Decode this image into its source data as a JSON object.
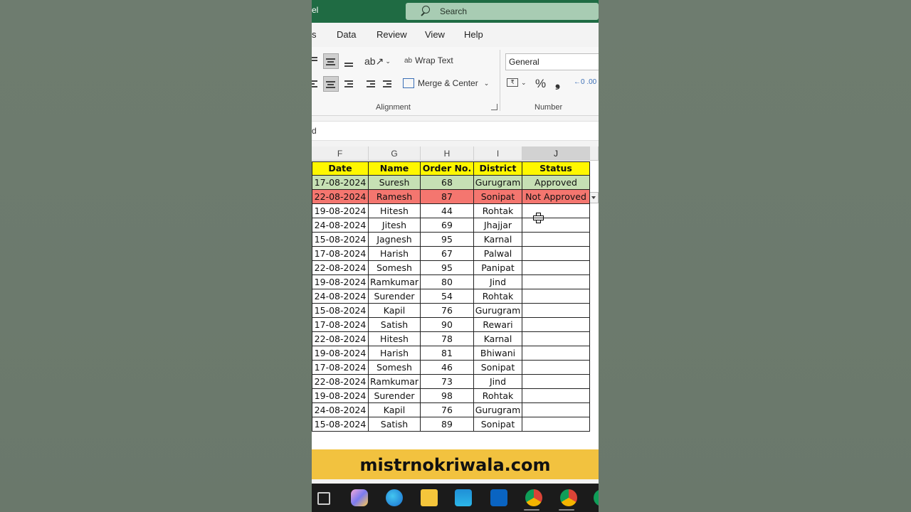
{
  "titlebar": {
    "app_fragment": "el",
    "search_label": "Search"
  },
  "ribbon_tabs": [
    "s",
    "Data",
    "Review",
    "View",
    "Help"
  ],
  "ribbon": {
    "wrap_text": "Wrap Text",
    "merge_center": "Merge & Center",
    "alignment_group": "Alignment",
    "number_format": "General",
    "number_group": "Number",
    "percent": "%",
    "comma": "❟"
  },
  "formula_bar": {
    "fragment": "d"
  },
  "columns": [
    "F",
    "G",
    "H",
    "I",
    "J"
  ],
  "selected_column": "J",
  "table": {
    "headers": [
      "Date",
      "Name",
      "Order No.",
      "District",
      "Status"
    ],
    "rows": [
      [
        "17-08-2024",
        "Suresh",
        "68",
        "Gurugram",
        "Approved"
      ],
      [
        "22-08-2024",
        "Ramesh",
        "87",
        "Sonipat",
        "Not Approved"
      ],
      [
        "19-08-2024",
        "Hitesh",
        "44",
        "Rohtak",
        ""
      ],
      [
        "24-08-2024",
        "Jitesh",
        "69",
        "Jhajjar",
        ""
      ],
      [
        "15-08-2024",
        "Jagnesh",
        "95",
        "Karnal",
        ""
      ],
      [
        "17-08-2024",
        "Harish",
        "67",
        "Palwal",
        ""
      ],
      [
        "22-08-2024",
        "Somesh",
        "95",
        "Panipat",
        ""
      ],
      [
        "19-08-2024",
        "Ramkumar",
        "80",
        "Jind",
        ""
      ],
      [
        "24-08-2024",
        "Surender",
        "54",
        "Rohtak",
        ""
      ],
      [
        "15-08-2024",
        "Kapil",
        "76",
        "Gurugram",
        ""
      ],
      [
        "17-08-2024",
        "Satish",
        "90",
        "Rewari",
        ""
      ],
      [
        "22-08-2024",
        "Hitesh",
        "78",
        "Karnal",
        ""
      ],
      [
        "19-08-2024",
        "Harish",
        "81",
        "Bhiwani",
        ""
      ],
      [
        "17-08-2024",
        "Somesh",
        "46",
        "Sonipat",
        ""
      ],
      [
        "22-08-2024",
        "Ramkumar",
        "73",
        "Jind",
        ""
      ],
      [
        "19-08-2024",
        "Surender",
        "98",
        "Rohtak",
        ""
      ],
      [
        "24-08-2024",
        "Kapil",
        "76",
        "Gurugram",
        ""
      ],
      [
        "15-08-2024",
        "Satish",
        "89",
        "Sonipat",
        ""
      ]
    ]
  },
  "colors": {
    "header_fill": "#fff700",
    "approved_fill": "#c6e0b4",
    "not_approved_fill": "#f4766f",
    "banner": "#f2c23f",
    "titlebar": "#1f6b43"
  },
  "banner_text": "mistrnokriwala.com",
  "taskbar_icons": [
    "task-view-icon",
    "copilot-icon",
    "edge-icon",
    "file-explorer-icon",
    "store-icon",
    "outlook-icon",
    "chrome-icon",
    "chrome-profile-icon",
    "app-icon"
  ]
}
